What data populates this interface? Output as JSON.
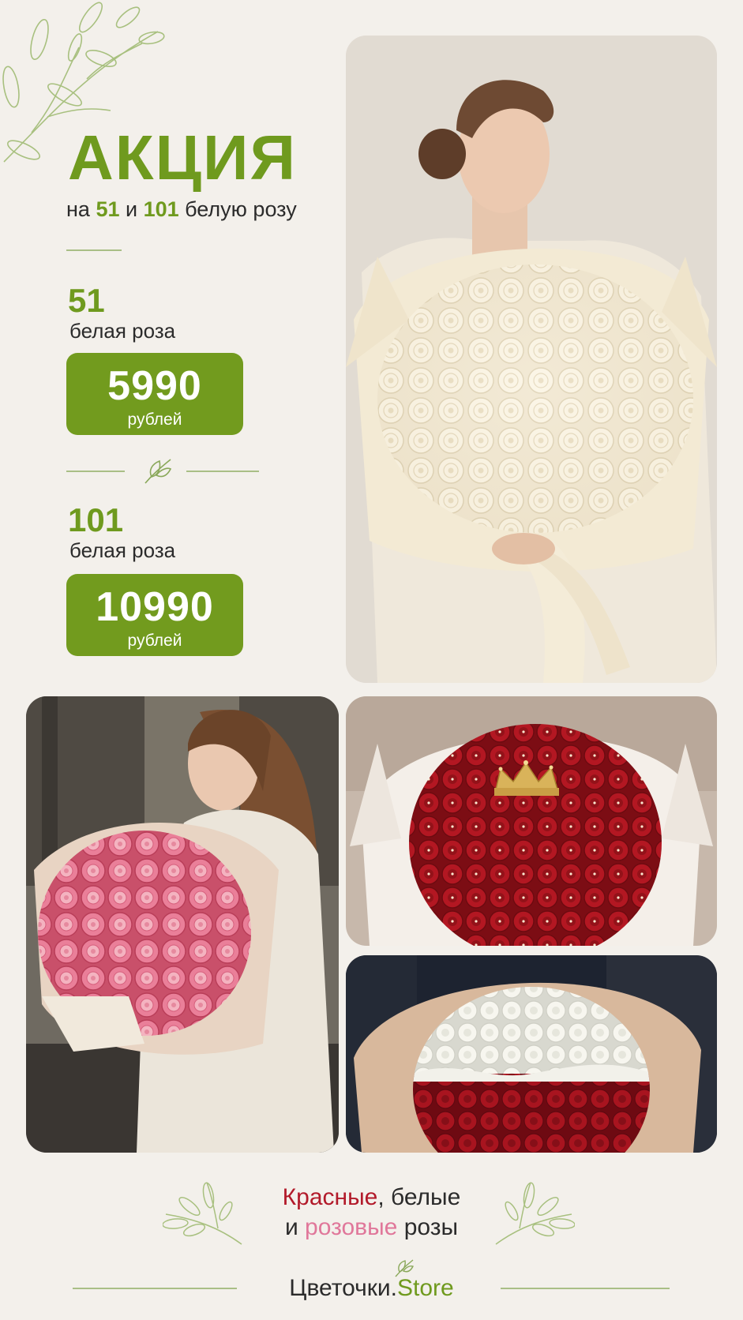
{
  "promo": {
    "title": "АКЦИЯ",
    "subtitle_pre": "на ",
    "subtitle_num1": "51",
    "subtitle_mid": " и ",
    "subtitle_num2": "101",
    "subtitle_post": " белую розу"
  },
  "offers": [
    {
      "count": "51",
      "label": "белая роза",
      "price": "5990",
      "currency": "рублей"
    },
    {
      "count": "101",
      "label": "белая роза",
      "price": "10990",
      "currency": "рублей"
    }
  ],
  "caption": {
    "red_word": "Красные",
    "line1_rest": ", белые",
    "line2_pre": "и ",
    "pink_word": "розовые",
    "line2_post": " розы"
  },
  "brand": {
    "name": "Цветочки.",
    "suffix": "Store"
  },
  "colors": {
    "accent_green": "#729b1e",
    "background": "#f3f0eb",
    "red_text": "#b21a2a",
    "pink_text": "#e0779a"
  },
  "icons": [
    "branch-icon",
    "leaf-icon",
    "crown-icon"
  ]
}
